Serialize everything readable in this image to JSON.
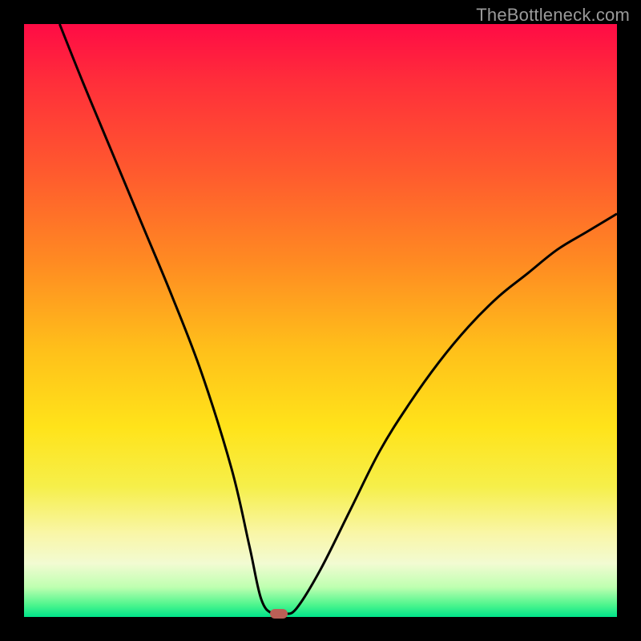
{
  "watermark": "TheBottleneck.com",
  "colors": {
    "curve_stroke": "#000000",
    "marker_fill": "#bb5f56"
  },
  "chart_data": {
    "type": "line",
    "title": "",
    "xlabel": "",
    "ylabel": "",
    "xlim": [
      0,
      100
    ],
    "ylim": [
      0,
      100
    ],
    "grid": false,
    "series": [
      {
        "name": "curve",
        "x": [
          6,
          10,
          15,
          20,
          25,
          30,
          35,
          38,
          40,
          42,
          44,
          46,
          50,
          55,
          60,
          65,
          70,
          75,
          80,
          85,
          90,
          95,
          100
        ],
        "y": [
          100,
          90,
          78,
          66,
          54,
          41,
          25,
          12,
          3,
          0.5,
          0.5,
          1.5,
          8,
          18,
          28,
          36,
          43,
          49,
          54,
          58,
          62,
          65,
          68
        ]
      }
    ],
    "marker": {
      "x": 43,
      "y": 0.5
    }
  }
}
